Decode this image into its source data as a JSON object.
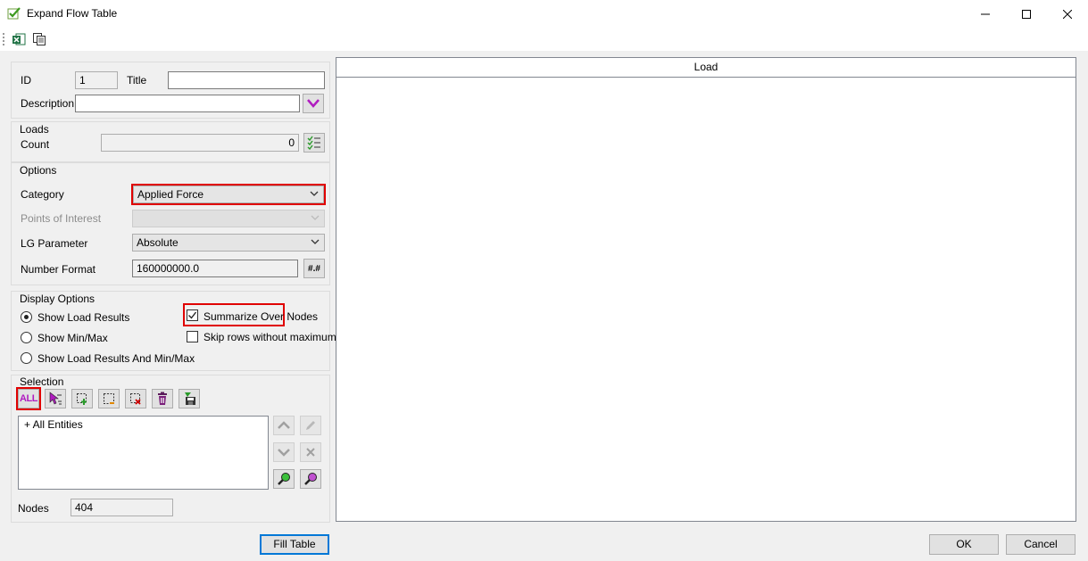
{
  "window": {
    "title": "Expand Flow Table",
    "minimize_glyph": "—",
    "maximize_glyph": "☐",
    "close_glyph": "✕"
  },
  "toolbar": {
    "icons": [
      "excel-export-icon",
      "copy-icon"
    ]
  },
  "general": {
    "id_label": "ID",
    "id_value": "1",
    "title_label": "Title",
    "title_value": "",
    "description_label": "Description",
    "description_value": ""
  },
  "loads": {
    "group_label": "Loads",
    "count_label": "Count",
    "count_value": "0"
  },
  "options": {
    "group_label": "Options",
    "category_label": "Category",
    "category_value": "Applied Force",
    "poi_label": "Points of Interest",
    "poi_value": "",
    "lg_label": "LG Parameter",
    "lg_value": "Absolute",
    "number_format_label": "Number Format",
    "number_format_value": "160000000.0",
    "number_format_button": "#.#"
  },
  "display_options": {
    "group_label": "Display Options",
    "radios": [
      {
        "label": "Show Load Results",
        "checked": true
      },
      {
        "label": "Show Min/Max",
        "checked": false
      },
      {
        "label": "Show Load Results And Min/Max",
        "checked": false
      }
    ],
    "summarize_label": "Summarize Over Nodes",
    "summarize_checked": true,
    "skip_rows_label": "Skip rows without maximum",
    "skip_rows_checked": false,
    "check_glyph": "✓"
  },
  "selection": {
    "group_label": "Selection",
    "all_button": "ALL",
    "list_items": [
      "+ All Entities"
    ],
    "nodes_label": "Nodes",
    "nodes_value": "404"
  },
  "table": {
    "column_header": "Load"
  },
  "buttons": {
    "fill_table": "Fill Table",
    "ok": "OK",
    "cancel": "Cancel"
  },
  "colors": {
    "highlight": "#e00000",
    "accent": "#0078d7"
  }
}
